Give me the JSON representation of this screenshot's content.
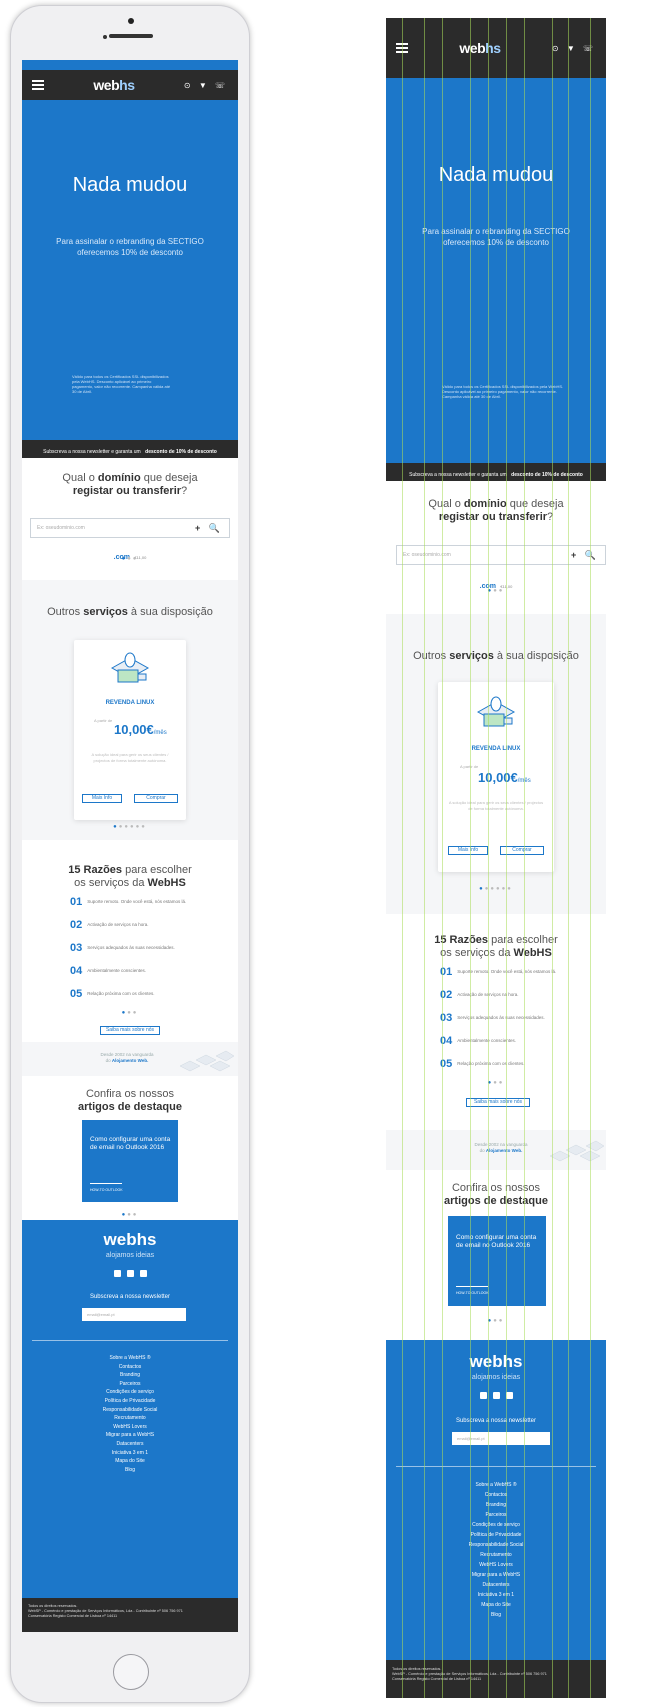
{
  "brand": {
    "logo_main": "web",
    "logo_accent": "hs",
    "tagline": "alojamos ideias"
  },
  "header": {
    "menu_icon": "hamburger-icon",
    "icons": [
      "help-icon",
      "cart-icon",
      "phone-icon"
    ],
    "icons_text": "⊙ ▼ ☏"
  },
  "hero": {
    "title": "Nada mudou",
    "subtitle": "Para assinalar o rebranding da SECTIGO oferecemos 10% de desconto",
    "fineprint": "Válido para todos os Certificados SSL disponibilizados pela WebHS. Desconto aplicável ao primeiro pagamento, valor não recorrente. Campanha válida até 30 de Abril."
  },
  "newsletter_strip": {
    "text": "Subscreva a nossa newsletter e garanta um",
    "bold": "desconto de 10% de desconto"
  },
  "domain": {
    "q1": "Qual o",
    "q1_bold": "domínio",
    "q1_rest": "que deseja",
    "q2_bold": "registar ou transferir",
    "q2_rest": "?",
    "placeholder": "Ex: oseudominio.com",
    "actions": "+ 🔍",
    "tld": ".com",
    "tld_price": "€11,00"
  },
  "services": {
    "title": "Outros",
    "title_bold": "serviços",
    "title_rest": "à sua disposição",
    "card": {
      "name": "REVENDA LINUX",
      "from": "A partir de",
      "price": "10,00€",
      "unit": "/mês",
      "description": "A solução ideal para gerir os seus clientes / projectos de forma totalmente autónoma.",
      "more": "Mais Info",
      "buy": "Comprar"
    }
  },
  "reasons": {
    "title_bold1": "15 Razões",
    "title_rest1": "para escolher",
    "title_line2": "os serviços da",
    "title_bold2": "WebHS",
    "items": [
      {
        "n": "01",
        "text": "Suporte remoto. Onde você está, nós estamos lá."
      },
      {
        "n": "02",
        "text": "Activação de serviços na hora."
      },
      {
        "n": "03",
        "text": "Serviços adequados às suas necessidades."
      },
      {
        "n": "04",
        "text": "Ambientalmente conscientes."
      },
      {
        "n": "05",
        "text": "Relação próxima com os clientes."
      }
    ],
    "cta": "Saiba mais sobre nós"
  },
  "since": {
    "line1": "Desde 2002 na vanguarda",
    "line2": "do",
    "bold": "Alojamento Web."
  },
  "articles": {
    "title1": "Confira os nossos",
    "title2_bold": "artigos de destaque",
    "card_title": "Como configurar uma conta de email no Outlook 2016",
    "card_tag": "HOW-TO OUTLOOK"
  },
  "footer": {
    "newsletter": "Subscreva a nossa newsletter",
    "email_placeholder": "email@email.pt",
    "links": [
      "Sobre a WebHS ®",
      "Contactos",
      "Branding",
      "Parceiros",
      "Condições de serviço",
      "Política de Privacidade",
      "Responsabilidade Social",
      "Recrutamento",
      "WebHS Lovers",
      "Migrar para a WebHS",
      "Datacenters",
      "Iniciativa 3 em 1",
      "Mapa do Site",
      "Blog"
    ],
    "legal1": "Todos os direitos reservados.",
    "legal2": "WebSP - Comércio e prestação de Serviços Informáticos, Lda - Contribuinte nº 506 756 971",
    "legal3": "Conservatória Registo Comercial de Lisboa nº 14411"
  },
  "colors": {
    "primary": "#1c77c9",
    "dark": "#2b2b2b",
    "guides": "#aadc5a"
  }
}
